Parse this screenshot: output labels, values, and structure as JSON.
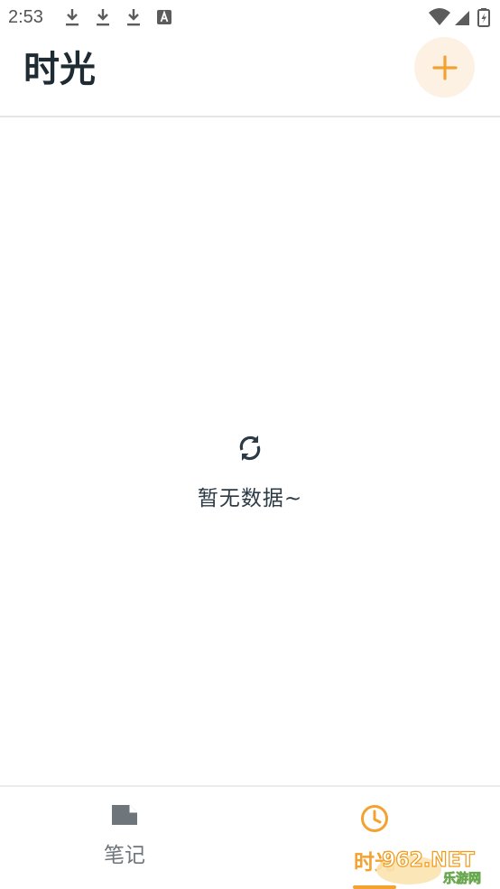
{
  "status_bar": {
    "time": "2:53",
    "icons": [
      "download-icon",
      "download-icon",
      "download-icon",
      "app-notification-icon",
      "wifi-icon",
      "cell-signal-icon",
      "battery-icon"
    ]
  },
  "header": {
    "title": "时光",
    "add_button_icon": "plus-icon"
  },
  "empty_state": {
    "icon": "refresh-icon",
    "text": "暂无数据~"
  },
  "bottom_nav": {
    "items": [
      {
        "label": "笔记",
        "icon": "note-icon",
        "active": false
      },
      {
        "label": "时光",
        "icon": "clock-icon",
        "active": true
      }
    ]
  },
  "watermark": {
    "text_main": "962.NET",
    "text_sub": "乐游网"
  },
  "colors": {
    "accent": "#f3a22f",
    "accent_bg": "#fdf1e3",
    "title": "#1f2b33",
    "inactive": "#6e767c"
  }
}
